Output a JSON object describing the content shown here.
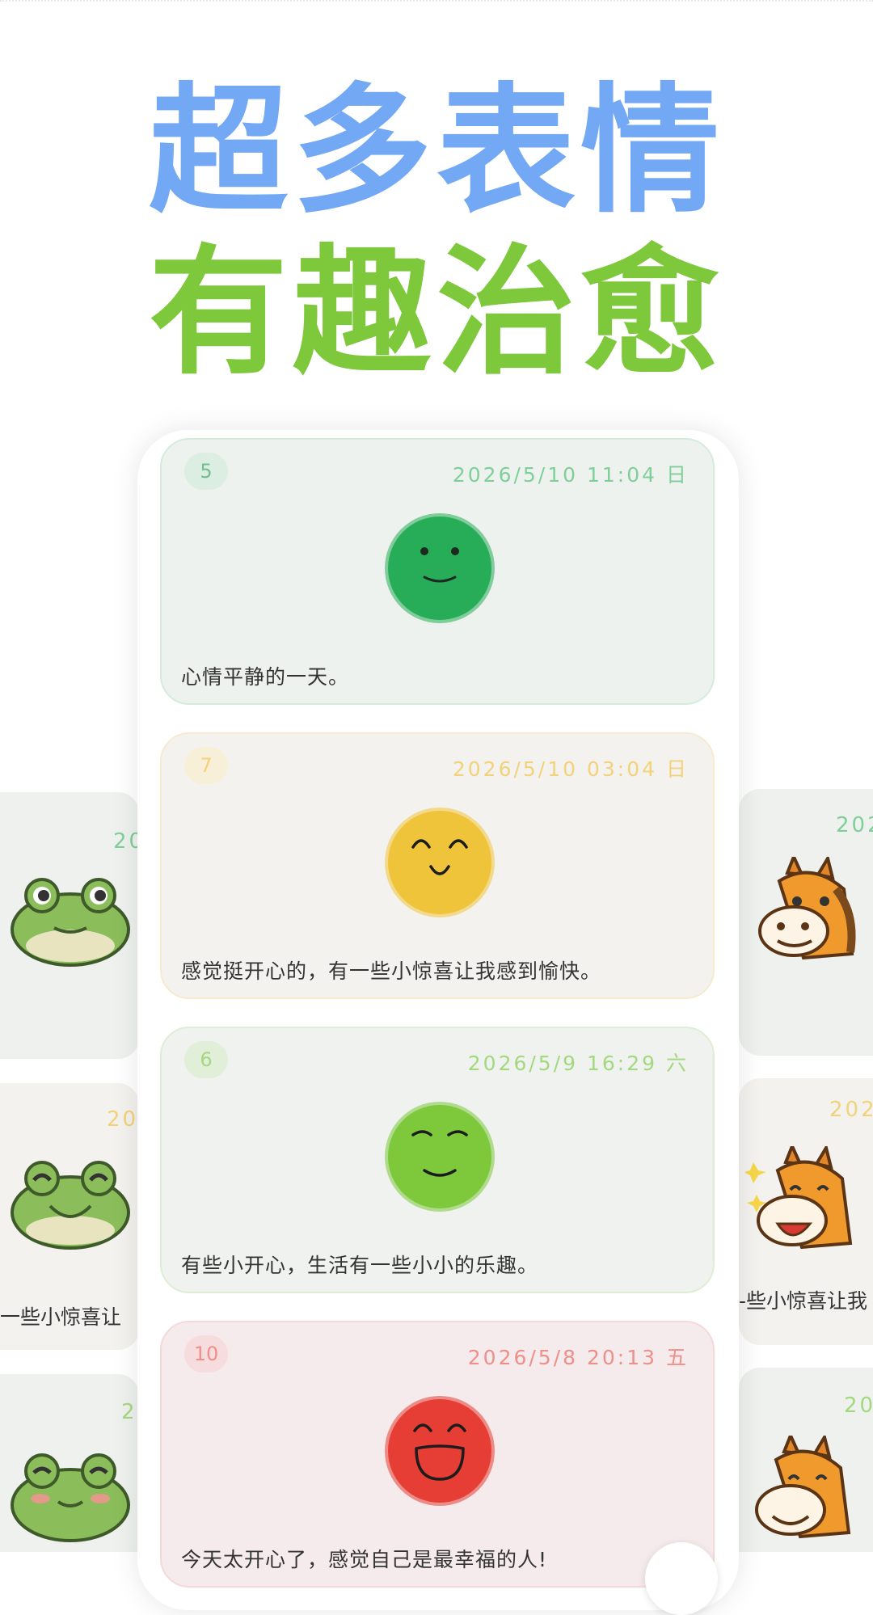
{
  "headline": {
    "line1": "超多表情",
    "line2": "有趣治愈"
  },
  "entries": [
    {
      "index": "5",
      "date": "2026/5/10 11:04 日",
      "note": "心情平静的一天。",
      "mood": "calm",
      "color": "#27ad58"
    },
    {
      "index": "7",
      "date": "2026/5/10 03:04 日",
      "note": "感觉挺开心的，有一些小惊喜让我感到愉快。",
      "mood": "happy",
      "color": "#f0c43a"
    },
    {
      "index": "6",
      "date": "2026/5/9 16:29 六",
      "note": "有些小开心，生活有一些小小的乐趣。",
      "mood": "content",
      "color": "#7ec83c"
    },
    {
      "index": "10",
      "date": "2026/5/8 20:13 五",
      "note": "今天太开心了，感觉自己是最幸福的人!",
      "mood": "ecstatic",
      "color": "#e63d35"
    }
  ],
  "left_cards": [
    {
      "date": "20",
      "note": ""
    },
    {
      "date": "20",
      "note": "一些小惊喜让"
    },
    {
      "date": "2",
      "note": ""
    }
  ],
  "right_cards": [
    {
      "date": "202",
      "note": ""
    },
    {
      "date": "202",
      "note": "-些小惊喜让我"
    },
    {
      "date": "20",
      "note": ""
    }
  ],
  "icons": [
    "calm-face-icon",
    "smile-face-icon",
    "content-face-icon",
    "laugh-face-icon",
    "frog-sticker-icon",
    "horse-sticker-icon"
  ]
}
